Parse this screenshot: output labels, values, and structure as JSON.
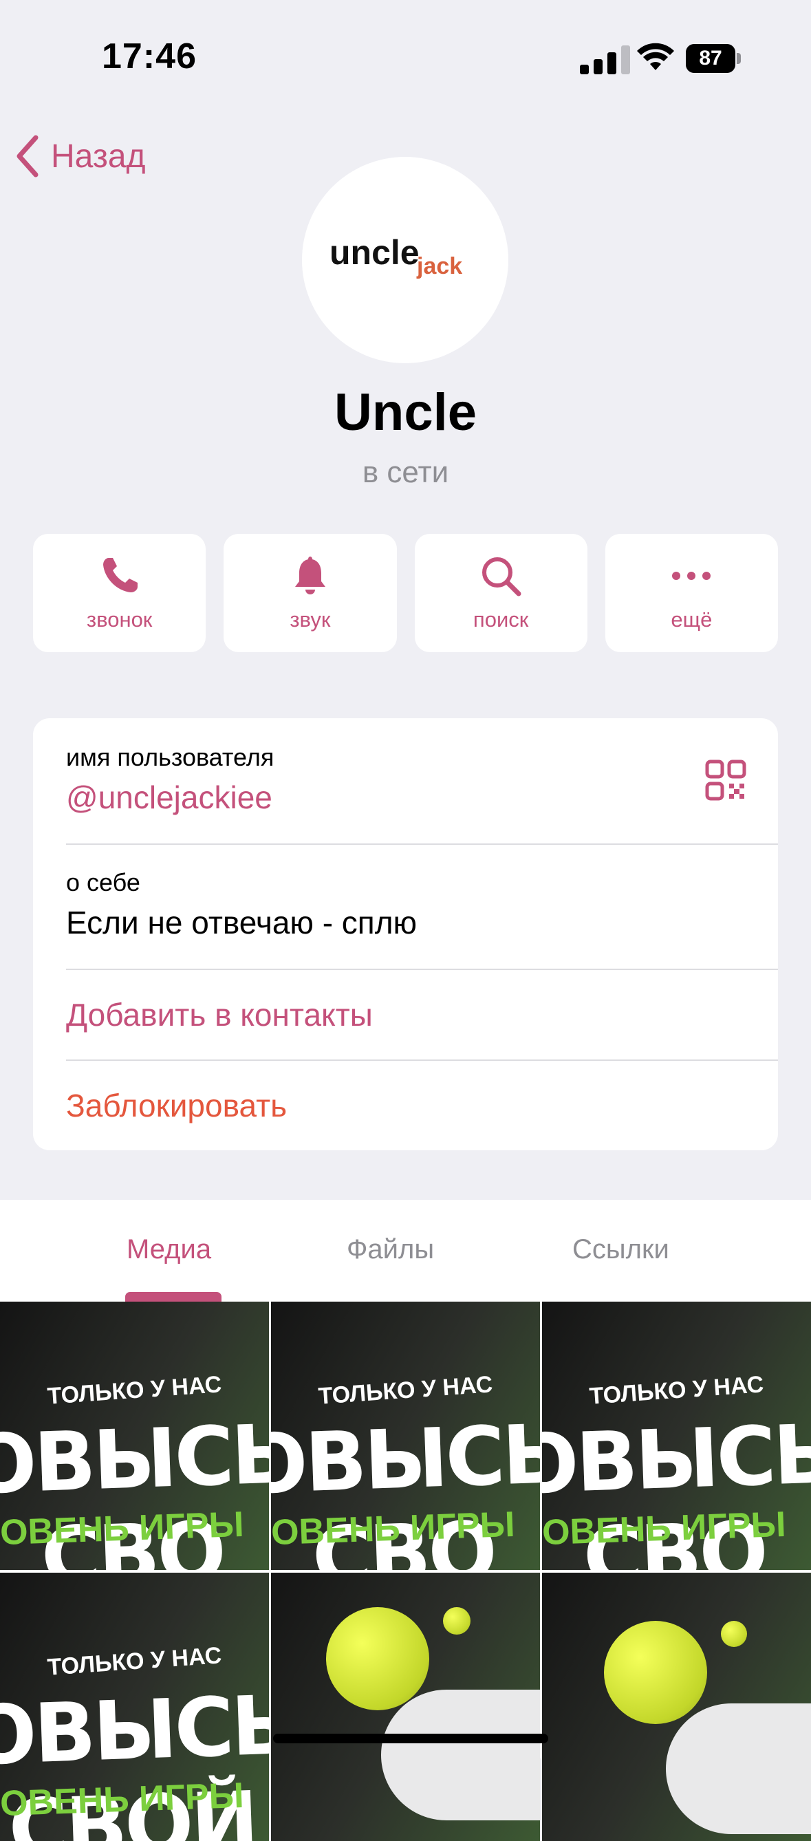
{
  "status_bar": {
    "time": "17:46",
    "battery": "87"
  },
  "nav": {
    "back_label": "Назад"
  },
  "profile": {
    "logo_main": "uncle",
    "logo_accent": "jack",
    "name": "Uncle",
    "status": "в сети"
  },
  "actions": [
    {
      "label": "звонок",
      "icon": "phone-icon"
    },
    {
      "label": "звук",
      "icon": "bell-icon"
    },
    {
      "label": "поиск",
      "icon": "search-icon"
    },
    {
      "label": "ещё",
      "icon": "more-icon"
    }
  ],
  "info": {
    "username_label": "имя пользователя",
    "username_value": "@unclejackiee",
    "about_label": "о себе",
    "about_value": "Если не отвечаю - сплю",
    "add_contact": "Добавить в контакты",
    "block": "Заблокировать"
  },
  "tabs": {
    "media": "Медиа",
    "files": "Файлы",
    "links": "Ссылки",
    "active": "media"
  },
  "media_tiles": {
    "small_text": "ТОЛЬКО У НАС",
    "big_text": "ОВЫСЬ СВО",
    "big_text_alt": "ОВЫСЬ СВОЙ",
    "green_text": "ОВЕНЬ ИГРЫ"
  },
  "colors": {
    "accent": "#c4517b",
    "danger": "#e4573d",
    "background": "#efeff4"
  }
}
